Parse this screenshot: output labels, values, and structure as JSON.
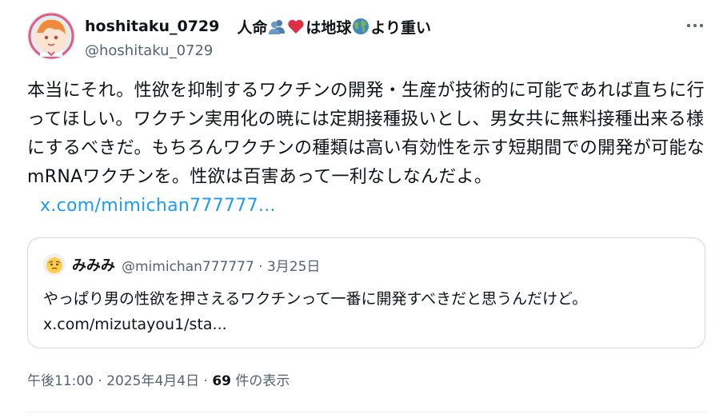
{
  "author": {
    "display_name": "hoshitaku_0729",
    "bio_parts": [
      "人命",
      "は地球",
      "より重い"
    ],
    "handle": "@hoshitaku_0729"
  },
  "tweet": {
    "text": "本当にそれ。性欲を抑制するワクチンの開発・生産が技術的に可能であれば直ちに行ってほしい。ワクチン実用化の暁には定期接種扱いとし、男女共に無料接種出来る様にするべきだ。もちろんワクチンの種類は高い有効性を示す短期間での開発が可能なmRNAワクチンを。性欲は百害あって一利なしなんだよ。",
    "link": "x.com/mimichan777777..."
  },
  "quote": {
    "name": "みみみ",
    "handle": "@mimichan777777",
    "date": "3月25日",
    "meta": "@mimichan777777 · 3月25日",
    "text": "やっぱり男の性欲を押さえるワクチンって一番に開発すべきだと思うんだけど。",
    "link": "x.com/mizutayou1/sta..."
  },
  "meta": {
    "time_date": "午後11:00 · 2025年4月4日 · ",
    "views_count": "69",
    "views_label": " 件の表示"
  },
  "icons": {
    "more": "more-horizontal-icon",
    "people": "people-silhouette-icon",
    "heart": "red-heart-icon",
    "globe": "earth-globe-icon"
  },
  "colors": {
    "link": "#1d9bf0",
    "secondary_text": "#536471",
    "heart": "#e0245e"
  }
}
